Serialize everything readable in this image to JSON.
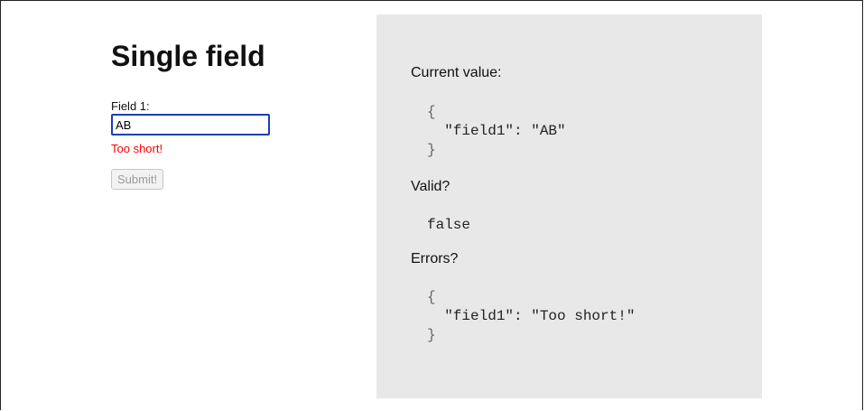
{
  "form": {
    "title": "Single field",
    "field_label": "Field 1:",
    "field_value": "AB",
    "error": "Too short!",
    "submit_label": "Submit!"
  },
  "debug_panel": {
    "current_value_heading": "Current value:",
    "current_value_open": "{",
    "current_value_line": "\"field1\": \"AB\"",
    "current_value_close": "}",
    "valid_heading": "Valid?",
    "valid_value": "false",
    "errors_heading": "Errors?",
    "errors_open": "{",
    "errors_line": "\"field1\": \"Too short!\"",
    "errors_close": "}"
  },
  "colors": {
    "error": "#ff0000",
    "input_focus_border": "#1a3fb5",
    "panel_background": "#e8e8e8"
  }
}
